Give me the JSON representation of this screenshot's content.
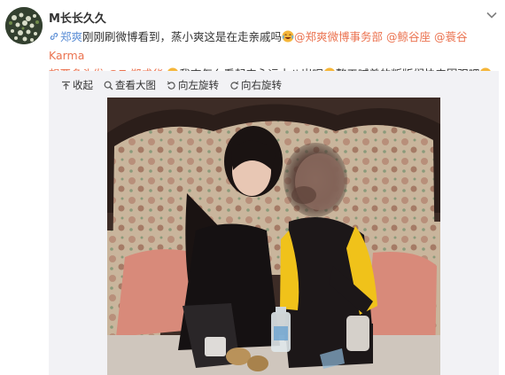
{
  "user": {
    "name": "M长长久久"
  },
  "post": {
    "link_label": "郑爽",
    "text_part1": "刚刚刷微博看到，蒸小爽这是在走亲戚吗",
    "mention1": "@郑爽微博事务部",
    "mention2": "@鲸谷座",
    "mention3": "@蓑谷Karma",
    "mention4": "想要多头发",
    "mention5": "@Z-郑成华",
    "text_part2": "我爽怎么看起来永远十八岁呢",
    "text_part3": "整天喊着的叛版们快来围观吧"
  },
  "toolbar": {
    "collapse": "收起",
    "view_large": "查看大图",
    "rotate_left": "向左旋转",
    "rotate_right": "向右旋转"
  },
  "icons": {
    "menu": "chevron-down-icon",
    "link": "link-icon",
    "emoji": "laugh-cry-emoji-icon",
    "collapse": "arrow-up-icon",
    "view_large": "magnifier-icon",
    "rotate_left": "rotate-left-icon",
    "rotate_right": "rotate-right-icon"
  },
  "colors": {
    "mention": "#eb7350",
    "link_blue": "#5d8fd6",
    "media_bg": "#f2f2f5"
  }
}
